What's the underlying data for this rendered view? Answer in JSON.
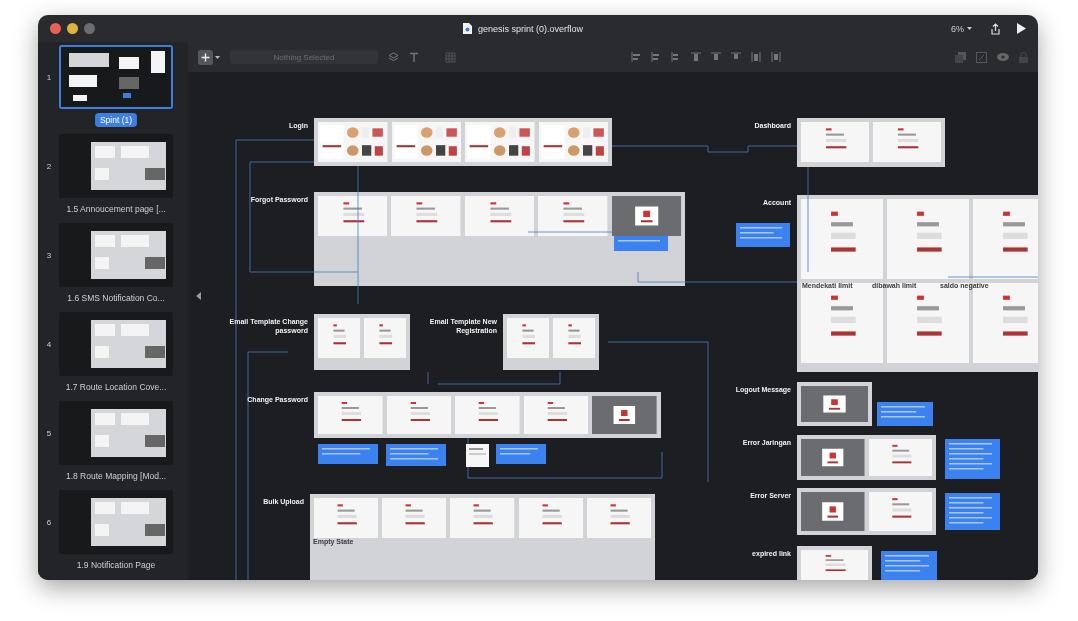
{
  "window": {
    "title": "genesis sprint (0).overflow",
    "zoom": "6%"
  },
  "toolbar": {
    "selection_placeholder": "Nothing Selected"
  },
  "sidebar": {
    "pages": [
      {
        "number": "1",
        "name": "Spint (1)",
        "selected": true
      },
      {
        "number": "2",
        "name": "1.5 Annoucement page [...",
        "selected": false
      },
      {
        "number": "3",
        "name": "1.6 SMS Notification Co...",
        "selected": false
      },
      {
        "number": "4",
        "name": "1.7 Route Location Cove...",
        "selected": false
      },
      {
        "number": "5",
        "name": "1.8 Route Mapping [Mod...",
        "selected": false
      },
      {
        "number": "6",
        "name": "1.9 Notification Page",
        "selected": false
      }
    ]
  },
  "canvas": {
    "sections": [
      {
        "label": "Login"
      },
      {
        "label": "Forgot Password"
      },
      {
        "label": "Email Template Change password"
      },
      {
        "label": "Email Template New Registration"
      },
      {
        "label": "Change Password"
      },
      {
        "label": "Bulk Upload"
      },
      {
        "label": "Dashboard"
      },
      {
        "label": "Account"
      },
      {
        "label": "Logout Message"
      },
      {
        "label": "Error Jaringan"
      },
      {
        "label": "Error Server"
      },
      {
        "label": "expired link"
      }
    ],
    "sublabels": [
      "Empty State",
      "Mendekati limit",
      "dibawah limit",
      "saldo negative"
    ]
  }
}
